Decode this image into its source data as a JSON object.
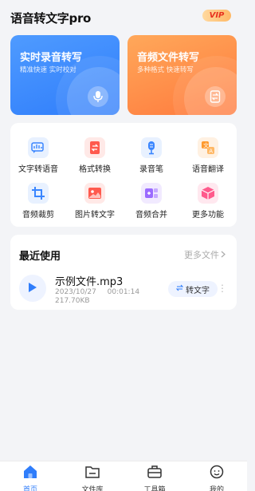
{
  "header": {
    "app_title": "语音转文字pro",
    "vip_label": "VIP"
  },
  "feature_cards": [
    {
      "title": "实时录音转写",
      "subtitle": "精准快速 实时校对",
      "icon": "mic-icon",
      "color": "#2f7dfb"
    },
    {
      "title": "音频文件转写",
      "subtitle": "多种格式 快速转写",
      "icon": "file-transfer-icon",
      "color": "#ff7a3d"
    }
  ],
  "tools": [
    {
      "label": "文字转语音",
      "icon": "text-to-speech-icon",
      "color": "#3a86ff"
    },
    {
      "label": "格式转换",
      "icon": "format-convert-icon",
      "color": "#ff5a4e"
    },
    {
      "label": "录音笔",
      "icon": "recorder-pen-icon",
      "color": "#3a86ff"
    },
    {
      "label": "语音翻译",
      "icon": "translate-icon",
      "color": "#ff9a2e"
    },
    {
      "label": "音频裁剪",
      "icon": "crop-icon",
      "color": "#3a86ff"
    },
    {
      "label": "图片转文字",
      "icon": "image-to-text-icon",
      "color": "#ff5a4e"
    },
    {
      "label": "音频合并",
      "icon": "merge-icon",
      "color": "#9b6bff"
    },
    {
      "label": "更多功能",
      "icon": "more-cube-icon",
      "color": "#ff5a8c"
    }
  ],
  "recent": {
    "title": "最近使用",
    "more_label": "更多文件",
    "file": {
      "name": "示例文件.mp3",
      "date": "2023/10/27",
      "duration": "00:01:14",
      "size": "217.70KB",
      "action_label": "转文字"
    }
  },
  "bottom_nav": [
    {
      "label": "首页",
      "icon": "home-icon",
      "active": true
    },
    {
      "label": "文件库",
      "icon": "folder-icon",
      "active": false
    },
    {
      "label": "工具箱",
      "icon": "toolbox-icon",
      "active": false
    },
    {
      "label": "我的",
      "icon": "profile-icon",
      "active": false
    }
  ],
  "colors": {
    "accent": "#2f7dfb",
    "orange": "#ff7a3d",
    "background": "#f3f4f7"
  }
}
